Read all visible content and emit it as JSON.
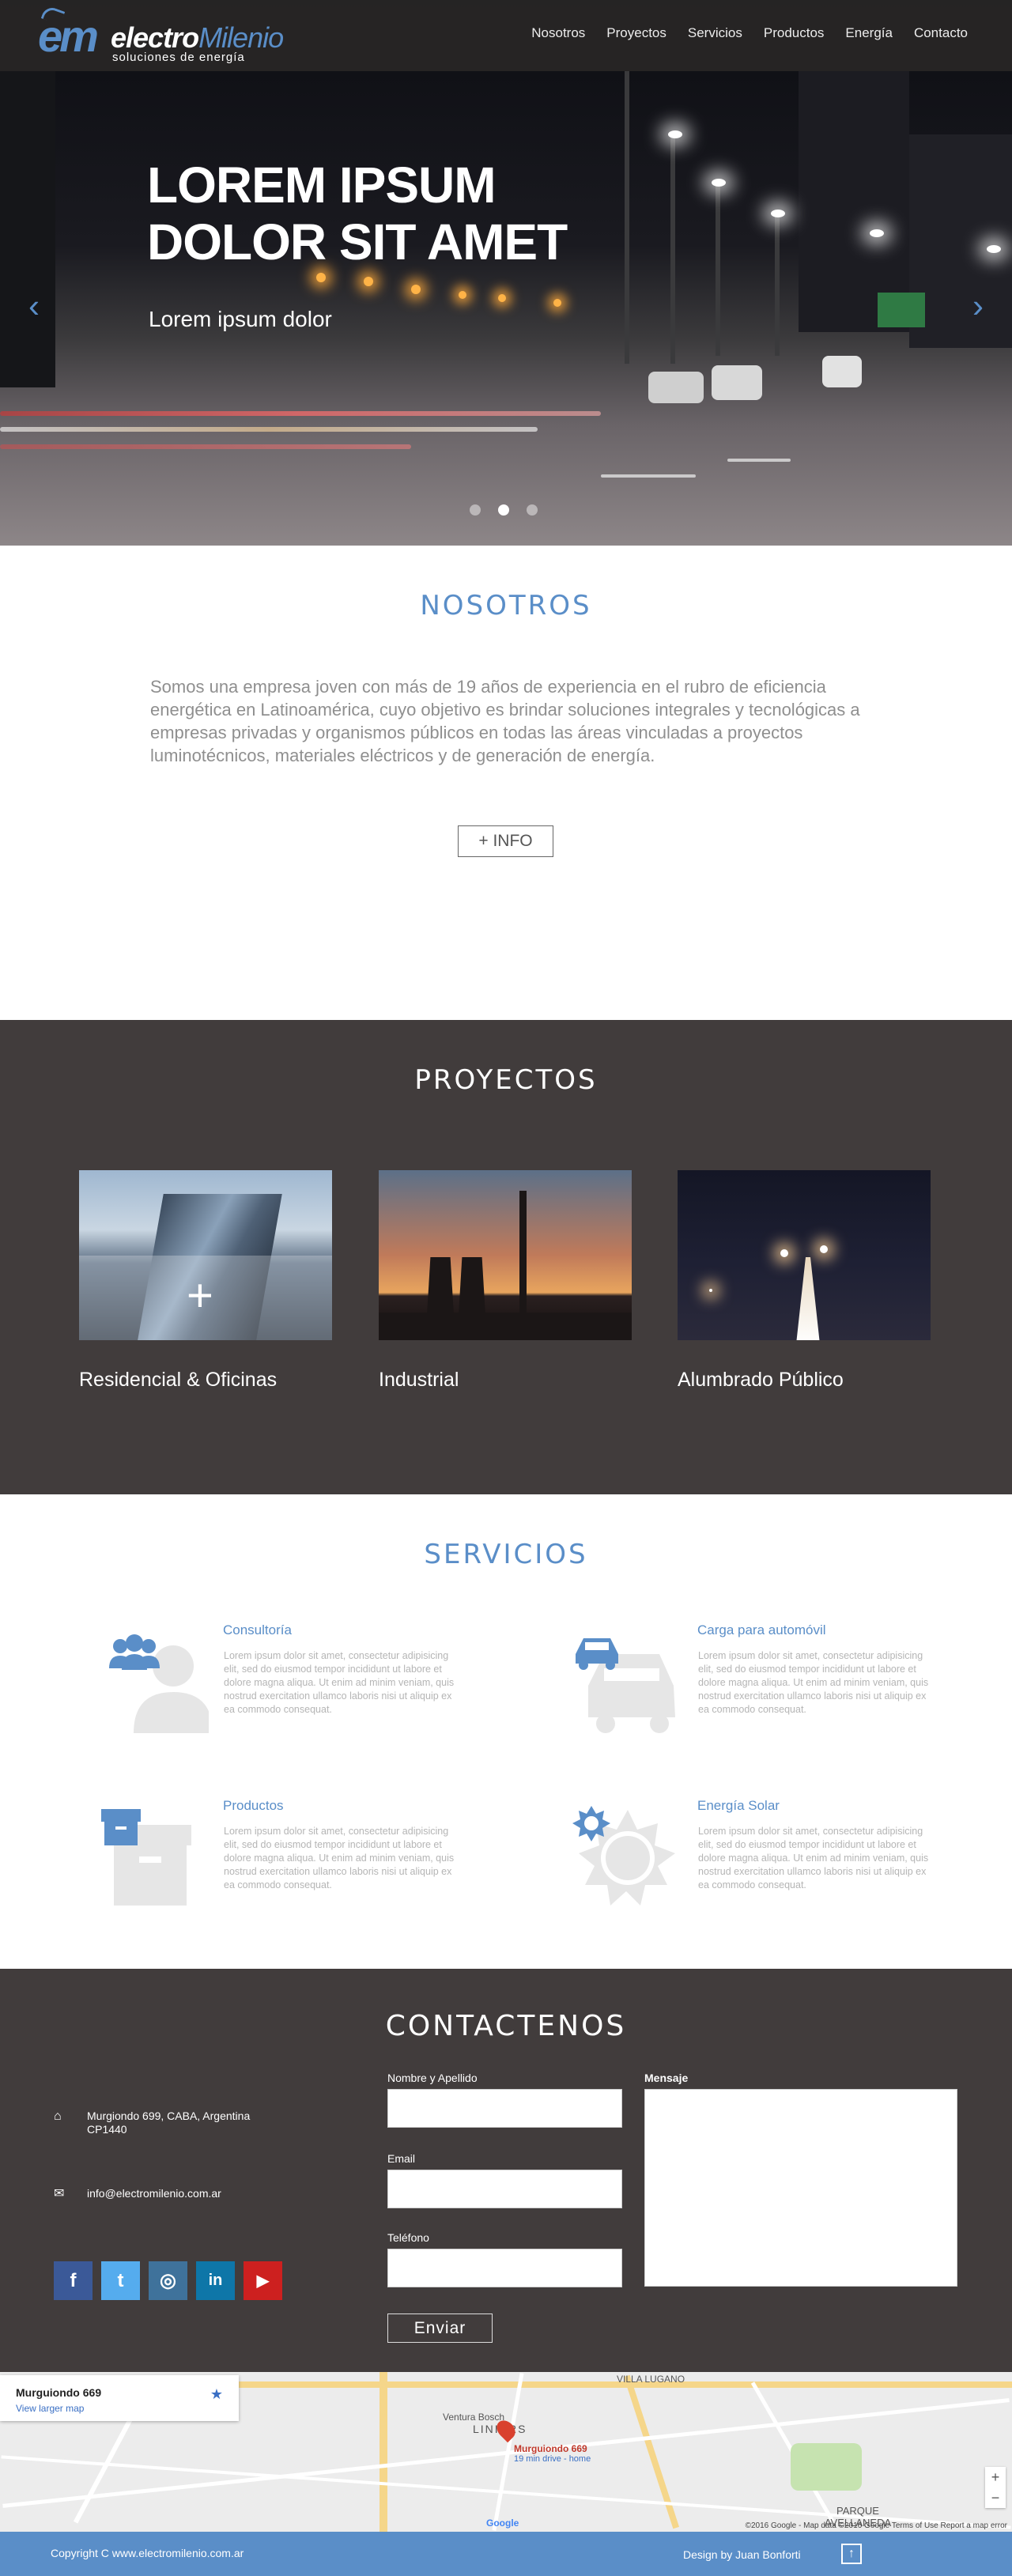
{
  "brand": {
    "logo_em": "em",
    "name_part1": "electro",
    "name_part2": "Milenio",
    "slogan": "soluciones de energía"
  },
  "nav": {
    "items": [
      "Nosotros",
      "Proyectos",
      "Servicios",
      "Productos",
      "Energía",
      "Contacto"
    ]
  },
  "hero": {
    "title": "LOREM IPSUM DOLOR SIT AMET",
    "subtitle": "Lorem ipsum dolor",
    "prev_icon": "chevron-left-icon",
    "next_icon": "chevron-right-icon",
    "slides_total": 3,
    "active_slide": 2
  },
  "nosotros": {
    "title": "NOSOTROS",
    "text": "Somos una empresa joven con más de 19 años de experiencia en el rubro de eficiencia energética en Latinoamérica, cuyo objetivo es brindar soluciones integrales y tecnológicas a empresas privadas y organismos públicos en todas las áreas vinculadas a proyectos luminotécnicos, materiales eléctricos y de  generación de energía.",
    "button": "+ INFO"
  },
  "proyectos": {
    "title": "PROYECTOS",
    "items": [
      {
        "caption": "Residencial & Oficinas",
        "overlay_icon": "+"
      },
      {
        "caption": "Industrial"
      },
      {
        "caption": "Alumbrado Público"
      }
    ]
  },
  "servicios": {
    "title": "SERVICIOS",
    "items": [
      {
        "title": "Consultoría",
        "icon": "people-icon",
        "text": "Lorem ipsum dolor sit amet, consectetur adipisicing elit, sed do eiusmod tempor incididunt ut labore et dolore magna aliqua. Ut enim ad minim veniam, quis nostrud exercitation ullamco laboris nisi ut aliquip ex ea commodo consequat."
      },
      {
        "title": "Carga para automóvil",
        "icon": "car-icon",
        "text": "Lorem ipsum dolor sit amet, consectetur adipisicing elit, sed do eiusmod tempor incididunt ut labore et dolore magna aliqua. Ut enim ad minim veniam, quis nostrud exercitation ullamco laboris nisi ut aliquip ex ea commodo consequat."
      },
      {
        "title": "Productos",
        "icon": "box-icon",
        "text": "Lorem ipsum dolor sit amet, consectetur adipisicing elit, sed do eiusmod tempor incididunt ut labore et dolore magna aliqua. Ut enim ad minim veniam, quis nostrud exercitation ullamco laboris nisi ut aliquip ex ea commodo consequat."
      },
      {
        "title": "Energía Solar",
        "icon": "sun-icon",
        "text": "Lorem ipsum dolor sit amet, consectetur adipisicing elit, sed do eiusmod tempor incididunt ut labore et dolore magna aliqua. Ut enim ad minim veniam, quis nostrud exercitation ullamco laboris nisi ut aliquip ex ea commodo consequat."
      }
    ]
  },
  "contacto": {
    "title": "CONTACTENOS",
    "address_line1": "Murgiondo 699, CABA, Argentina",
    "address_line2": "CP1440",
    "email": "info@electromilenio.com.ar",
    "labels": {
      "name": "Nombre y Apellido",
      "email": "Email",
      "phone": "Teléfono",
      "message": "Mensaje"
    },
    "send_button": "Enviar",
    "socials": [
      {
        "name": "facebook",
        "glyph": "f",
        "color": "#3b5998"
      },
      {
        "name": "twitter",
        "glyph": "t",
        "color": "#55acee"
      },
      {
        "name": "instagram",
        "glyph": "◎",
        "color": "#3f729b"
      },
      {
        "name": "linkedin",
        "glyph": "in",
        "color": "#0e76a8"
      },
      {
        "name": "youtube",
        "glyph": "▶",
        "color": "#cd201f"
      }
    ]
  },
  "map": {
    "card_title": "Murguiondo 669",
    "card_link": "View larger map",
    "pin_title": "Murguiondo 669",
    "pin_sub": "19 min drive - home",
    "labels": [
      "VILLA LUGANO",
      "Ventura Bosch",
      "LINIERS",
      "PARQUE AVELLANEDA",
      "Google"
    ],
    "footer": "©2016 Google - Map data ©2016 Google   Terms of Use   Report a map error"
  },
  "footer": {
    "copyright": "Copyright C  www.electromilenio.com.ar",
    "design": "Design by Juan Bonforti",
    "up_icon": "arrow-up-icon"
  },
  "colors": {
    "accent": "#5a8ec8",
    "dark": "#413c3c",
    "footer": "#5a8ec8"
  }
}
